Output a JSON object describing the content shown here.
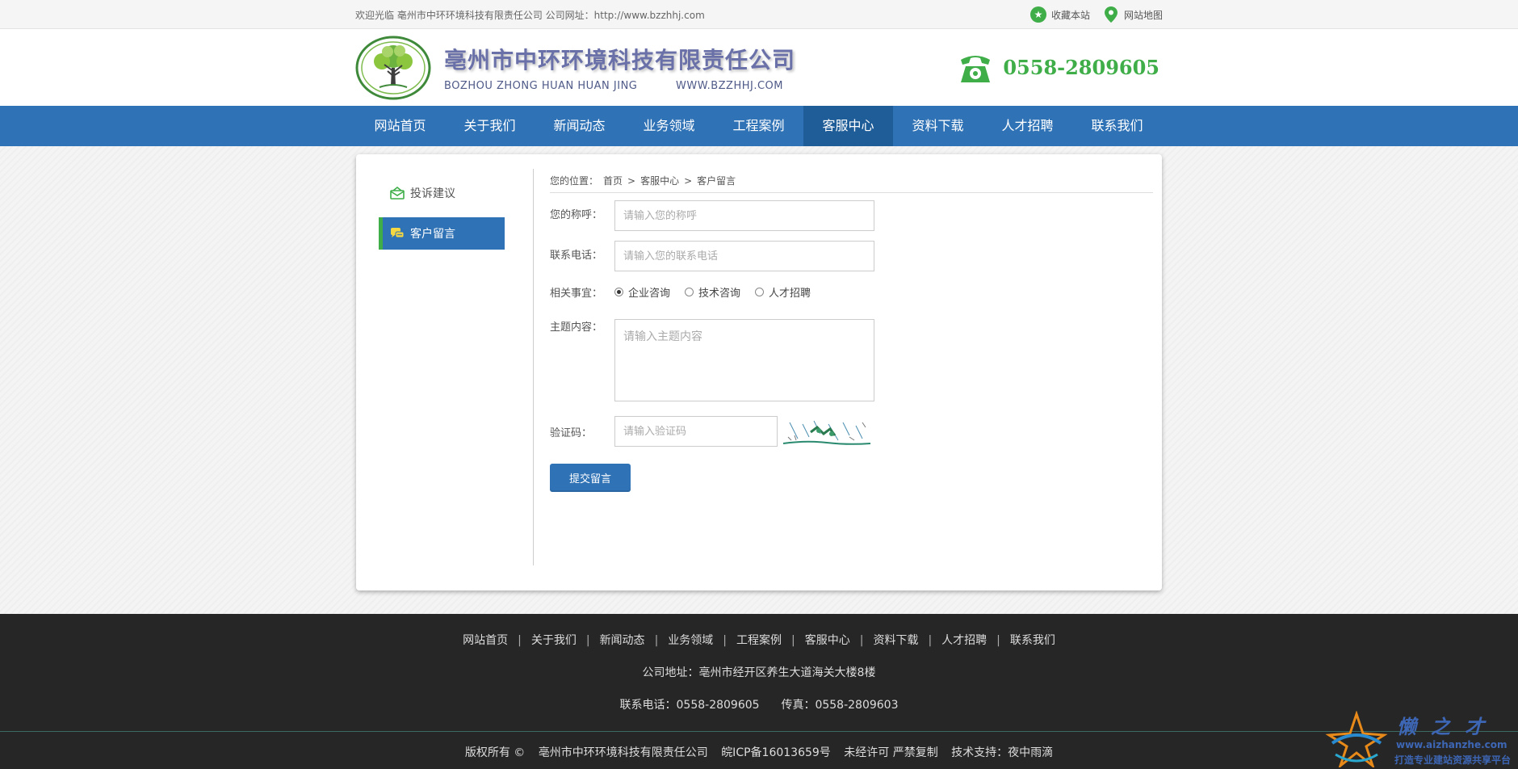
{
  "topbar": {
    "welcome": "欢迎光临 亳州市中环环境科技有限责任公司 公司网址：http://www.bzzhhj.com",
    "favorite": "收藏本站",
    "sitemap": "网站地图"
  },
  "header": {
    "company_name": "亳州市中环环境科技有限责任公司",
    "pinyin": "BOZHOU ZHONG HUAN HUAN JING",
    "domain": "WWW.BZZHHJ.COM",
    "hotline": "0558-2809605"
  },
  "nav": {
    "items": [
      "网站首页",
      "关于我们",
      "新闻动态",
      "业务领域",
      "工程案例",
      "客服中心",
      "资料下载",
      "人才招聘",
      "联系我们"
    ],
    "active": "客服中心"
  },
  "sidebar": {
    "items": [
      {
        "label": "投诉建议",
        "icon": "mail-icon",
        "active": false
      },
      {
        "label": "客户留言",
        "icon": "chat-icon",
        "active": true
      }
    ]
  },
  "breadcrumb": {
    "prefix": "您的位置：",
    "items": [
      "首页",
      "客服中心",
      "客户留言"
    ],
    "separator": ">"
  },
  "form": {
    "name_label": "您的称呼：",
    "name_placeholder": "请输入您的称呼",
    "phone_label": "联系电话：",
    "phone_placeholder": "请输入您的联系电话",
    "topic_label": "相关事宜：",
    "topic_options": [
      "企业咨询",
      "技术咨询",
      "人才招聘"
    ],
    "topic_selected": "企业咨询",
    "content_label": "主题内容：",
    "content_placeholder": "请输入主题内容",
    "code_label": "验证码：",
    "code_placeholder": "请输入验证码",
    "submit": "提交留言"
  },
  "footer": {
    "links": [
      "网站首页",
      "关于我们",
      "新闻动态",
      "业务领域",
      "工程案例",
      "客服中心",
      "资料下载",
      "人才招聘",
      "联系我们"
    ],
    "address": "公司地址：亳州市经开区养生大道海关大楼8楼",
    "phone": "联系电话：0558-2809605",
    "fax": "传真：0558-2809603",
    "copyright": [
      "版权所有 ©",
      "亳州市中环环境科技有限责任公司",
      "皖ICP备16013659号",
      "未经许可 严禁复制",
      "技术支持：夜中雨滴"
    ]
  },
  "watermark": {
    "title": "懒之才",
    "url": "www.aizhanzhe.com",
    "tagline": "打造专业建站资源共享平台"
  },
  "colors": {
    "nav_bg": "#2f72b5",
    "nav_active": "#1f5d98",
    "accent_green": "#3fae49",
    "footer_bg": "#262626"
  }
}
